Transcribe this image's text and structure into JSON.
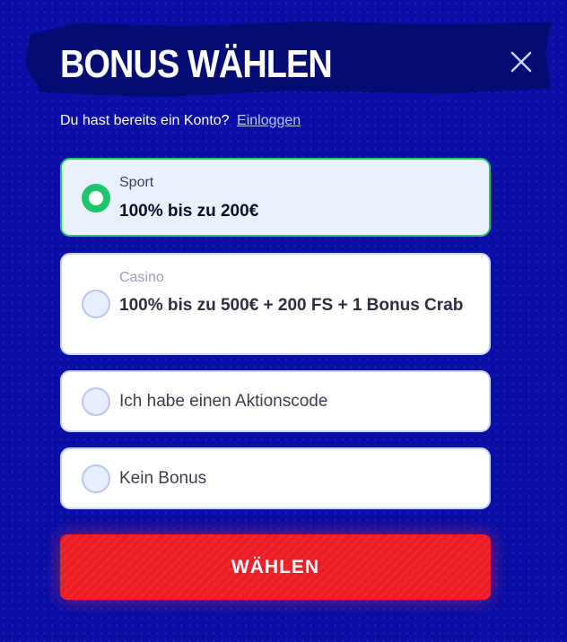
{
  "modal": {
    "title": "BONUS WÄHLEN",
    "subtitle_text": "Du hast bereits ein Konto?",
    "login_link": "Einloggen"
  },
  "options": [
    {
      "category": "Sport",
      "label": "100% bis zu 200€",
      "selected": true
    },
    {
      "category": "Casino",
      "label": "100% bis zu 500€ + 200 FS + 1 Bonus Crab",
      "selected": false
    },
    {
      "label": "Ich habe einen Aktionscode",
      "selected": false
    },
    {
      "label": "Kein Bonus",
      "selected": false
    }
  ],
  "submit_label": "WÄHLEN",
  "colors": {
    "background": "#0a0fa5",
    "selected_accent": "#1ec56a",
    "button": "#ee1c25"
  },
  "icons": {
    "close": "close-icon"
  }
}
